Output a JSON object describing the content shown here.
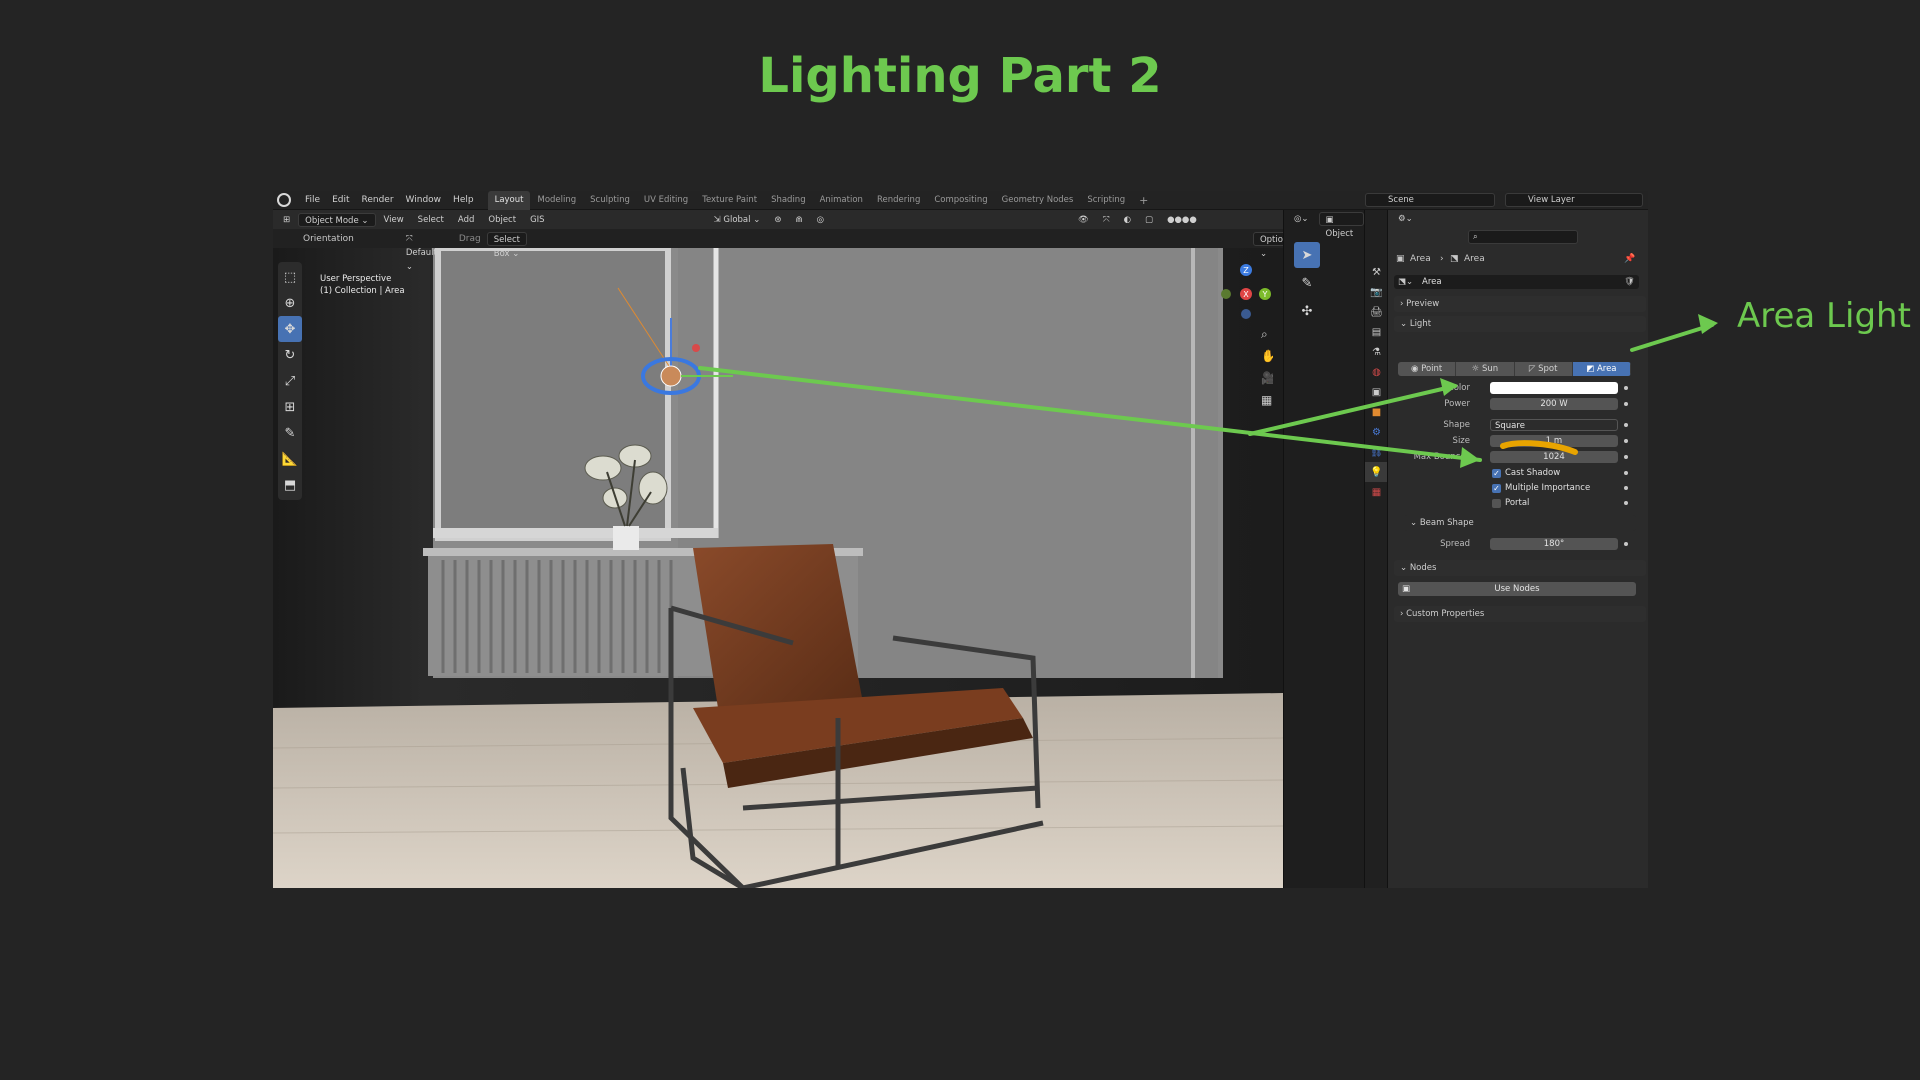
{
  "slide": {
    "title": "Lighting Part 2",
    "callout": "Area Light",
    "accent": "#6dc94f"
  },
  "topbar": {
    "menu": [
      "File",
      "Edit",
      "Render",
      "Window",
      "Help"
    ],
    "workspaces": [
      "Layout",
      "Modeling",
      "Sculpting",
      "UV Editing",
      "Texture Paint",
      "Shading",
      "Animation",
      "Rendering",
      "Compositing",
      "Geometry Nodes",
      "Scripting"
    ],
    "active_workspace": "Layout",
    "add_tab": "+",
    "scene": "Scene",
    "view_layer": "View Layer"
  },
  "viewport": {
    "mode": "Object Mode",
    "menus": [
      "View",
      "Select",
      "Add",
      "Object",
      "GIS"
    ],
    "transform_orientation": "Global",
    "orientation_label": "Orientation",
    "orientation_value": "Default",
    "drag_label": "Drag",
    "drag_value": "Select Box",
    "options": "Options",
    "perspective": "User Perspective",
    "collection": "(1) Collection | Area",
    "object_button": "Object",
    "gizmo_axes": [
      "Z",
      "X",
      "Y"
    ]
  },
  "properties": {
    "breadcrumb": [
      "Area",
      "Area"
    ],
    "datablock": "Area",
    "sections": {
      "preview": "Preview",
      "light": "Light",
      "beam_shape": "Beam Shape",
      "nodes": "Nodes",
      "custom": "Custom Properties"
    },
    "light_types": [
      "Point",
      "Sun",
      "Spot",
      "Area"
    ],
    "active_light_type": "Area",
    "fields": {
      "color_label": "Color",
      "color_value": "#ffffff",
      "power_label": "Power",
      "power_value": "200 W",
      "shape_label": "Shape",
      "shape_value": "Square",
      "size_label": "Size",
      "size_value": "1 m",
      "bounces_label": "Max Bounces",
      "bounces_value": "1024",
      "spread_label": "Spread",
      "spread_value": "180°"
    },
    "checkboxes": {
      "cast_shadow": "Cast Shadow",
      "multiple_importance": "Multiple Importance",
      "portal": "Portal"
    },
    "use_nodes": "Use Nodes"
  }
}
